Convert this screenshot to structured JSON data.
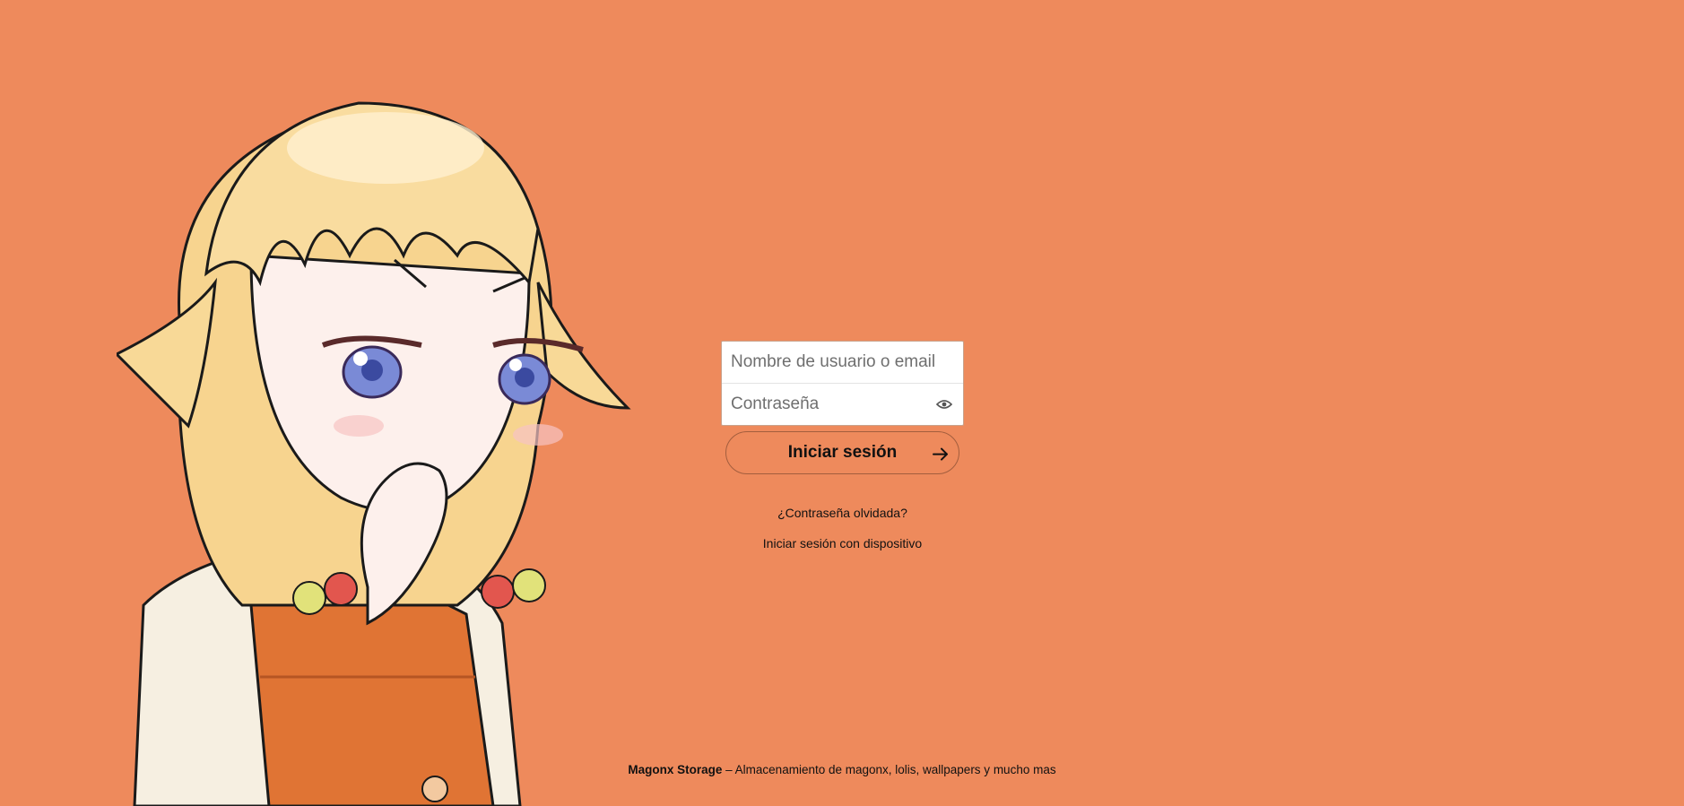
{
  "login": {
    "username_placeholder": "Nombre de usuario o email",
    "password_placeholder": "Contraseña",
    "password_toggle_icon": "eye-icon",
    "submit_label": "Iniciar sesión",
    "submit_icon": "arrow-right-icon"
  },
  "links": {
    "forgot_password": "¿Contraseña olvidada?",
    "device_login": "Iniciar sesión con dispositivo"
  },
  "footer": {
    "brand": "Magonx Storage",
    "separator": " – ",
    "tagline": "Almacenamiento de magonx, lolis, wallpapers y mucho mas"
  },
  "theme": {
    "background": "#ee8a5c"
  }
}
